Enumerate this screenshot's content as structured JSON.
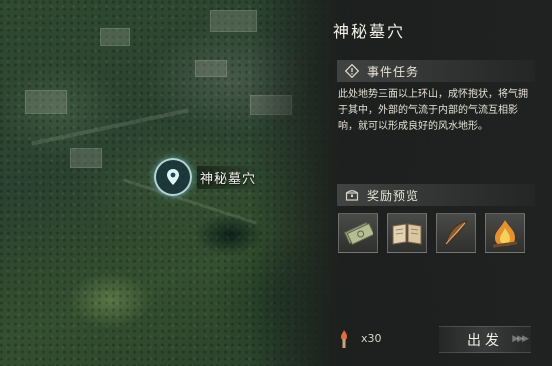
{
  "location": {
    "title": "神秘墓穴",
    "marker_label": "神秘墓穴"
  },
  "event_section": {
    "heading": "事件任务",
    "description": "此处地势三面以上环山，成怀抱状，将气拥于其中，外部的气流于内部的气流互相影响，就可以形成良好的风水地形。"
  },
  "reward_section": {
    "heading": "奖励预览",
    "items": [
      {
        "icon": "banknote-icon"
      },
      {
        "icon": "open-book-icon"
      },
      {
        "icon": "feather-quill-icon"
      },
      {
        "icon": "campfire-icon"
      }
    ]
  },
  "action": {
    "cost_icon": "torch-icon",
    "cost_count": "x30",
    "depart_label": "出发"
  },
  "colors": {
    "panel_bg": "#202222",
    "text": "#e6e2d6",
    "marker_glow": "#78dce6"
  }
}
